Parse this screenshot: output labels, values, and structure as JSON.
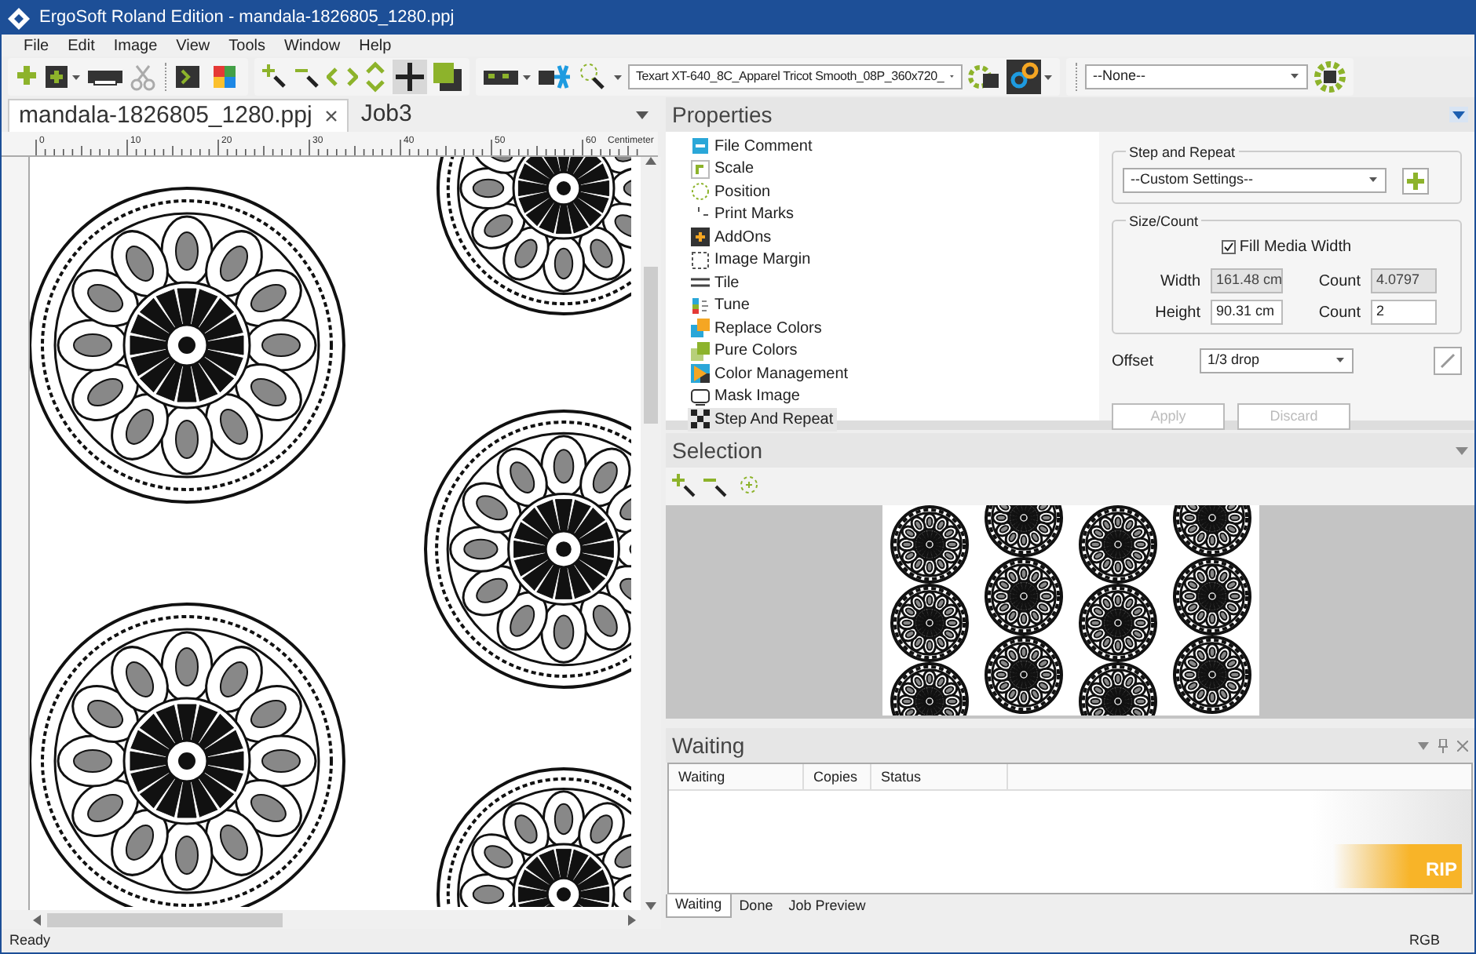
{
  "window": {
    "title": "ErgoSoft Roland Edition - mandala-1826805_1280.ppj"
  },
  "menu": [
    "File",
    "Edit",
    "Image",
    "View",
    "Tools",
    "Window",
    "Help"
  ],
  "toolbar": {
    "printer_select": "Texart XT-640_8C_Apparel Tricot Smooth_08P_360x720_",
    "preset_select": "--None--"
  },
  "doc_tabs": [
    {
      "label": "mandala-1826805_1280.ppj",
      "selected": true,
      "closable": true
    },
    {
      "label": "Job3",
      "selected": false,
      "closable": false
    }
  ],
  "ruler": {
    "labels": [
      "0",
      "10",
      "20",
      "30",
      "40",
      "50",
      "60"
    ],
    "unit": "Centimeter"
  },
  "properties": {
    "title": "Properties",
    "items": [
      {
        "label": "File Comment",
        "selected": false
      },
      {
        "label": "Scale",
        "selected": false
      },
      {
        "label": "Position",
        "selected": false
      },
      {
        "label": "Print Marks",
        "selected": false
      },
      {
        "label": "AddOns",
        "selected": false
      },
      {
        "label": "Image Margin",
        "selected": false
      },
      {
        "label": "Tile",
        "selected": false
      },
      {
        "label": "Tune",
        "selected": false
      },
      {
        "label": "Replace Colors",
        "selected": false
      },
      {
        "label": "Pure Colors",
        "selected": false
      },
      {
        "label": "Color Management",
        "selected": false
      },
      {
        "label": "Mask Image",
        "selected": false
      },
      {
        "label": "Step And Repeat",
        "selected": true
      }
    ]
  },
  "step_and_repeat": {
    "title": "Step and Repeat",
    "preset": "--Custom Settings--",
    "size_count_title": "Size/Count",
    "fill_media_width": {
      "label": "Fill Media Width",
      "checked": true
    },
    "fields": [
      {
        "label": "Width",
        "value": "161.48 cm",
        "disabled": true
      },
      {
        "label": "Count",
        "value": "4.0797",
        "disabled": true
      },
      {
        "label": "Height",
        "value": "90.31 cm",
        "disabled": false
      },
      {
        "label": "Count",
        "value": "2",
        "disabled": false
      }
    ],
    "offset_label": "Offset",
    "offset": "1/3 drop",
    "buttons": [
      {
        "label": "Apply",
        "disabled": true
      },
      {
        "label": "Discard",
        "disabled": true
      }
    ]
  },
  "selection": {
    "title": "Selection"
  },
  "waiting": {
    "title": "Waiting",
    "columns": [
      "Waiting",
      "Copies",
      "Status"
    ],
    "rip": "RIP",
    "tabs": [
      {
        "label": "Waiting",
        "selected": true
      },
      {
        "label": "Done",
        "selected": false
      },
      {
        "label": "Job Preview",
        "selected": false
      }
    ]
  },
  "status_bar": {
    "left": "Ready",
    "right": "RGB"
  }
}
